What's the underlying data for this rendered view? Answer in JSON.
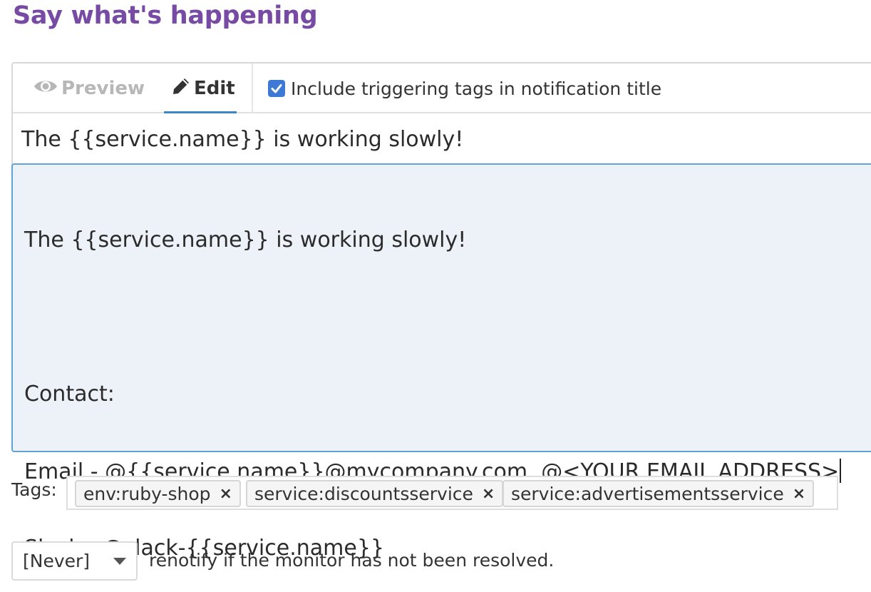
{
  "section": {
    "title": "Say what's happening"
  },
  "tabs": {
    "preview_label": "Preview",
    "edit_label": "Edit",
    "active": "Edit"
  },
  "include_tags": {
    "checked": true,
    "label": "Include triggering tags in notification title"
  },
  "title_input": {
    "value": "The {{service.name}} is working slowly!"
  },
  "message_body": {
    "lines": [
      "The {{service.name}} is working slowly!",
      "",
      "Contact:",
      "Email - @{{service.name}}@mycompany.com, @<YOUR EMAIL ADDRESS>",
      "Slack - @slack-{{service.name}}"
    ]
  },
  "tags": {
    "label": "Tags:",
    "items": [
      {
        "text": "env:ruby-shop",
        "remove": "×"
      },
      {
        "text": "service:discountsservice",
        "remove": "×"
      },
      {
        "text": "service:advertisementsservice",
        "remove": "×"
      }
    ]
  },
  "renotify": {
    "selected": "[Never]",
    "text": "renotify if the monitor has not been resolved."
  },
  "colors": {
    "title_purple": "#774aa4",
    "active_tab_underline": "#3b87c6",
    "checkbox_blue": "#3e79d6",
    "body_background": "#ecf2f8",
    "body_border": "#5fa2d6"
  }
}
